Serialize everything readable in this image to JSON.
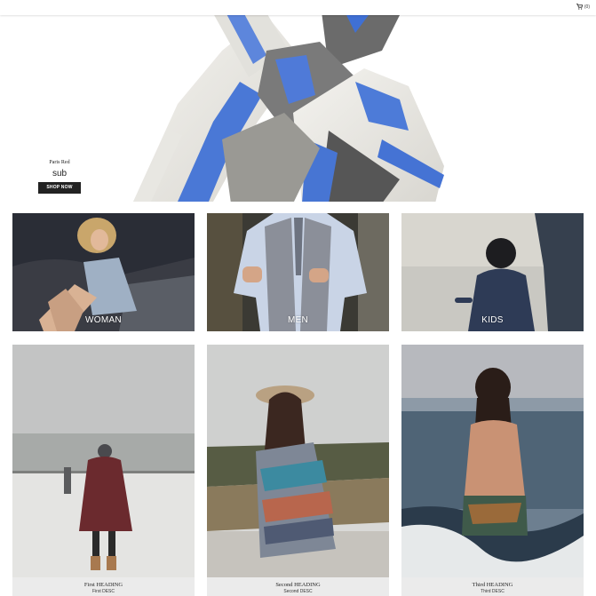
{
  "header": {
    "cart_label": "(0)"
  },
  "hero": {
    "title": "Paris Red",
    "subtitle": "sub",
    "button_label": "SHOP NOW"
  },
  "categories": [
    {
      "label": "WOMAN"
    },
    {
      "label": "MEN"
    },
    {
      "label": "KIDS"
    }
  ],
  "features": [
    {
      "heading": "First HEADING",
      "desc": "First DESC"
    },
    {
      "heading": "Second HEADING",
      "desc": "Second DESC"
    },
    {
      "heading": "Third HEADING",
      "desc": "Third DESC"
    }
  ]
}
